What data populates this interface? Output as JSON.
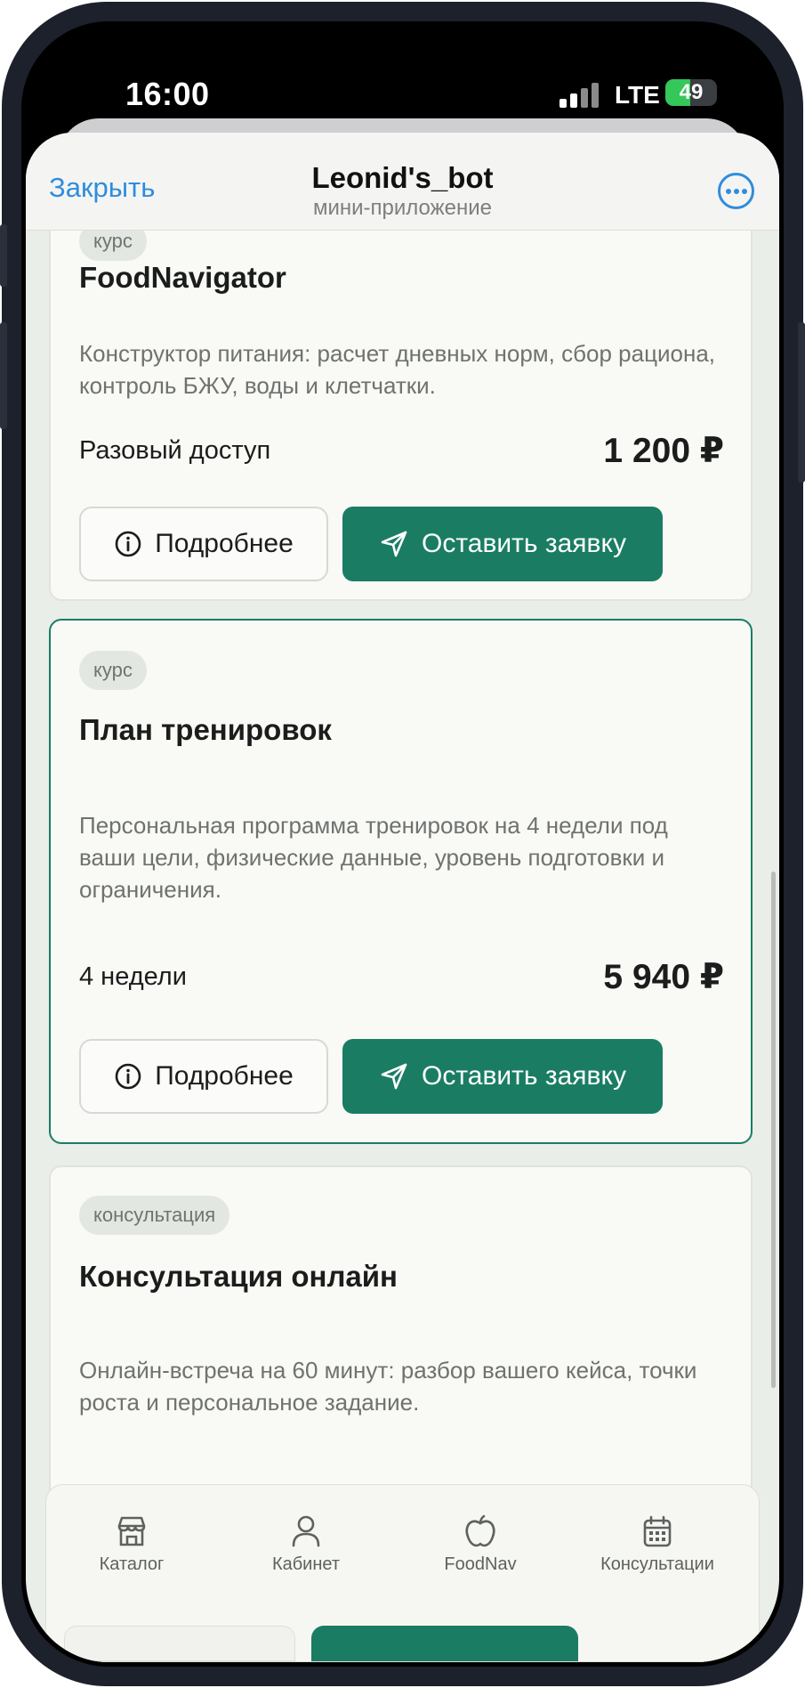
{
  "status_bar": {
    "time": "16:00",
    "network": "LTE",
    "battery": "49",
    "battery_level": 0.49
  },
  "header": {
    "close_label": "Закрыть",
    "title": "Leonid's_bot",
    "subtitle": "мини-приложение"
  },
  "cards": [
    {
      "badge": "курс",
      "title": "FoodNavigator",
      "description": "Конструктор питания: расчет дневных норм, сбор рациона, контроль БЖУ, воды и клетчатки.",
      "term": "Разовый доступ",
      "price": "1 200 ₽",
      "more_label": "Подробнее",
      "apply_label": "Оставить заявку"
    },
    {
      "badge": "курс",
      "title": "План тренировок",
      "description": "Персональная программа тренировок на 4 недели под ваши цели, физические данные, уровень подготовки и ограничения.",
      "term": "4 недели",
      "price": "5 940 ₽",
      "more_label": "Подробнее",
      "apply_label": "Оставить заявку"
    },
    {
      "badge": "консультация",
      "title": "Консультация онлайн",
      "description": "Онлайн-встреча на 60 минут: разбор вашего кейса, точки роста и персональное задание."
    }
  ],
  "tabbar": {
    "items": [
      {
        "label": "Каталог",
        "icon": "store-icon"
      },
      {
        "label": "Кабинет",
        "icon": "user-icon"
      },
      {
        "label": "FoodNav",
        "icon": "apple-icon"
      },
      {
        "label": "Консультации",
        "icon": "calendar-icon"
      }
    ]
  },
  "colors": {
    "accent": "#1a7d63",
    "link": "#2f8ddc",
    "background": "#eaeee9",
    "card": "#f9f9f6"
  }
}
